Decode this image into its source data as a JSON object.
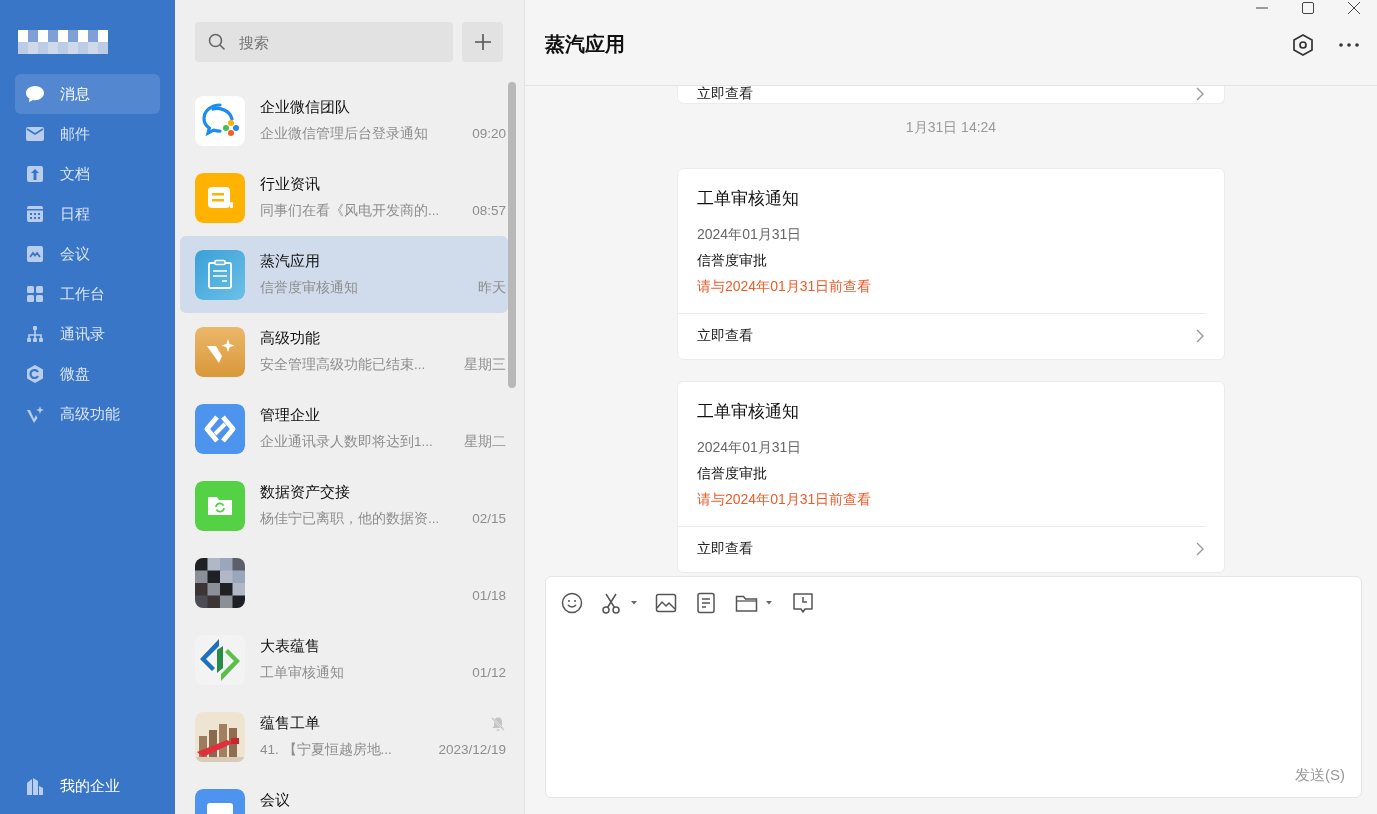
{
  "sidebar": {
    "items": [
      {
        "label": "消息",
        "selected": true
      },
      {
        "label": "邮件",
        "selected": false
      },
      {
        "label": "文档",
        "selected": false
      },
      {
        "label": "日程",
        "selected": false
      },
      {
        "label": "会议",
        "selected": false
      },
      {
        "label": "工作台",
        "selected": false
      },
      {
        "label": "通讯录",
        "selected": false
      },
      {
        "label": "微盘",
        "selected": false
      },
      {
        "label": "高级功能",
        "selected": false
      }
    ],
    "footer": {
      "label": "我的企业"
    }
  },
  "chat_list": {
    "search": {
      "placeholder": "搜索"
    },
    "chats": [
      {
        "name": "企业微信团队",
        "preview": "企业微信管理后台登录通知",
        "time": "09:20",
        "muted": false,
        "selected": false
      },
      {
        "name": "行业资讯",
        "preview": "同事们在看《风电开发商的...",
        "time": "08:57",
        "muted": false,
        "selected": false
      },
      {
        "name": "蒸汽应用",
        "preview": "信誉度审核通知",
        "time": "昨天",
        "muted": false,
        "selected": true
      },
      {
        "name": "高级功能",
        "preview": "安全管理高级功能已结束...",
        "time": "星期三",
        "muted": false,
        "selected": false
      },
      {
        "name": "管理企业",
        "preview": "企业通讯录人数即将达到1...",
        "time": "星期二",
        "muted": false,
        "selected": false
      },
      {
        "name": "数据资产交接",
        "preview": "杨佳宁已离职，他的数据资...",
        "time": "02/15",
        "muted": false,
        "selected": false
      },
      {
        "time": "01/18",
        "muted": false,
        "selected": false
      },
      {
        "name": "大表蕴售",
        "preview": "工单审核通知",
        "time": "01/12",
        "muted": false,
        "selected": false
      },
      {
        "name": "蕴售工单",
        "preview": "41. 【宁夏恒越房地...",
        "time": "2023/12/19",
        "muted": true,
        "selected": false
      },
      {
        "name": "会议",
        "muted": false,
        "selected": false
      }
    ]
  },
  "conversation": {
    "title": "蒸汽应用",
    "cards": [
      {
        "kind": "partial",
        "action": "立即查看"
      },
      {
        "kind": "separator",
        "text": "1月31日 14:24"
      },
      {
        "kind": "notice",
        "title": "工单审核通知",
        "date": "2024年01月31日",
        "subject": "信誉度审批",
        "deadline": "请与2024年01月31日前查看",
        "action": "立即查看"
      },
      {
        "kind": "notice",
        "title": "工单审核通知",
        "date": "2024年01月31日",
        "subject": "信誉度审批",
        "deadline": "请与2024年01月31日前查看",
        "action": "立即查看"
      }
    ]
  },
  "composer": {
    "send": "发送(S)"
  }
}
